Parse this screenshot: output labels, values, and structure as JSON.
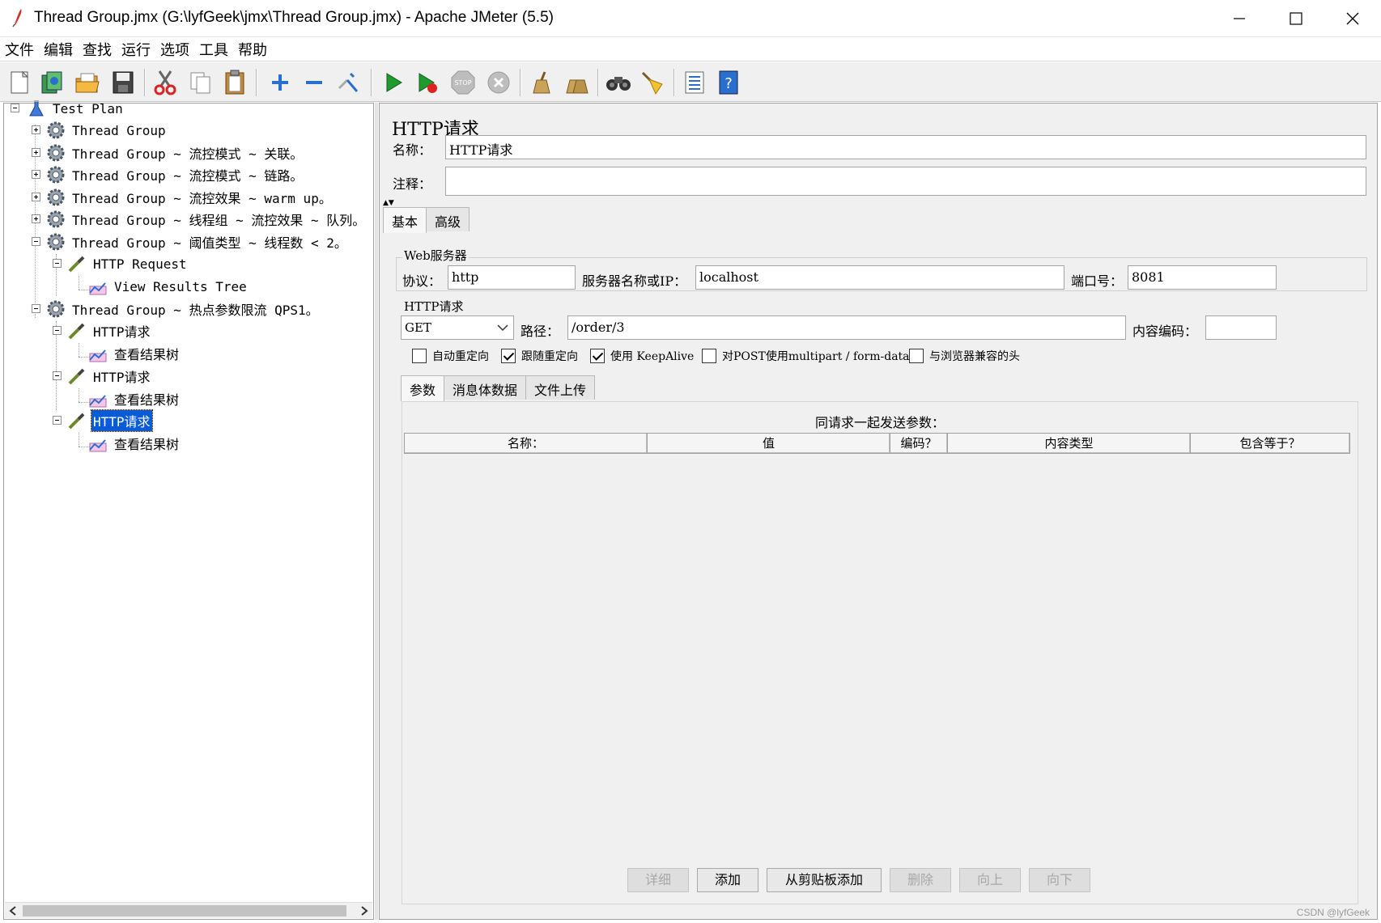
{
  "window": {
    "title": "Thread Group.jmx (G:\\lyfGeek\\jmx\\Thread Group.jmx) - Apache JMeter (5.5)"
  },
  "menu": [
    "文件",
    "编辑",
    "查找",
    "运行",
    "选项",
    "工具",
    "帮助"
  ],
  "toolbar": {
    "icons": [
      "new-icon",
      "templates-icon",
      "open-icon",
      "save-icon",
      "cut-icon",
      "copy-icon",
      "paste-icon",
      "expand-icon",
      "collapse-icon",
      "toggle-icon",
      "start-icon",
      "start-no-pauses-icon",
      "stop-icon",
      "shutdown-icon",
      "clear-icon",
      "clear-all-icon",
      "search-icon",
      "reset-search-icon",
      "function-helper-icon",
      "help-icon"
    ]
  },
  "tree": {
    "root": "Test Plan",
    "items": [
      {
        "label": "Thread Group",
        "type": "thread-group"
      },
      {
        "label": "Thread Group ~ 流控模式 ~ 关联。",
        "type": "thread-group"
      },
      {
        "label": "Thread Group ~ 流控模式 ~ 链路。",
        "type": "thread-group"
      },
      {
        "label": "Thread Group ~ 流控效果 ~ warm up。",
        "type": "thread-group"
      },
      {
        "label": "Thread Group ~ 线程组 ~ 流控效果 ~ 队列。",
        "type": "thread-group"
      },
      {
        "label": "Thread Group ~ 阈值类型 ~ 线程数 < 2。",
        "type": "thread-group"
      },
      {
        "label": "HTTP Request",
        "type": "sampler"
      },
      {
        "label": "View Results Tree",
        "type": "listener"
      },
      {
        "label": "Thread Group ~ 热点参数限流 QPS1。",
        "type": "thread-group"
      },
      {
        "label": "HTTP请求",
        "type": "sampler"
      },
      {
        "label": "查看结果树",
        "type": "listener"
      },
      {
        "label": "HTTP请求",
        "type": "sampler"
      },
      {
        "label": "查看结果树",
        "type": "listener"
      },
      {
        "label": "HTTP请求",
        "type": "sampler",
        "selected": true
      },
      {
        "label": "查看结果树",
        "type": "listener"
      }
    ]
  },
  "panel": {
    "title": "HTTP请求",
    "name_label": "名称：",
    "name_value": "HTTP请求",
    "comment_label": "注释：",
    "comment_value": "",
    "tabs": [
      "基本",
      "高级"
    ],
    "web_server": {
      "title": "Web服务器",
      "protocol_label": "协议：",
      "protocol_value": "http",
      "server_label": "服务器名称或IP：",
      "server_value": "localhost",
      "port_label": "端口号：",
      "port_value": "8081"
    },
    "http_request": {
      "title": "HTTP请求",
      "method": "GET",
      "path_label": "路径：",
      "path_value": "/order/3",
      "encoding_label": "内容编码：",
      "encoding_value": ""
    },
    "options": [
      {
        "label": "自动重定向",
        "checked": false
      },
      {
        "label": "跟随重定向",
        "checked": true
      },
      {
        "label": "使用 KeepAlive",
        "checked": true
      },
      {
        "label": "对POST使用multipart / form-data",
        "checked": false
      },
      {
        "label": "与浏览器兼容的头",
        "checked": false
      }
    ],
    "body_tabs": [
      "参数",
      "消息体数据",
      "文件上传"
    ],
    "params": {
      "caption": "同请求一起发送参数：",
      "columns": [
        "名称：",
        "值",
        "编码？",
        "内容类型",
        "包含等于？"
      ]
    },
    "buttons": [
      {
        "label": "详细",
        "enabled": false
      },
      {
        "label": "添加",
        "enabled": true
      },
      {
        "label": "从剪贴板添加",
        "enabled": true
      },
      {
        "label": "删除",
        "enabled": false
      },
      {
        "label": "向上",
        "enabled": false
      },
      {
        "label": "向下",
        "enabled": false
      }
    ]
  },
  "watermark": "CSDN @lyfGeek"
}
